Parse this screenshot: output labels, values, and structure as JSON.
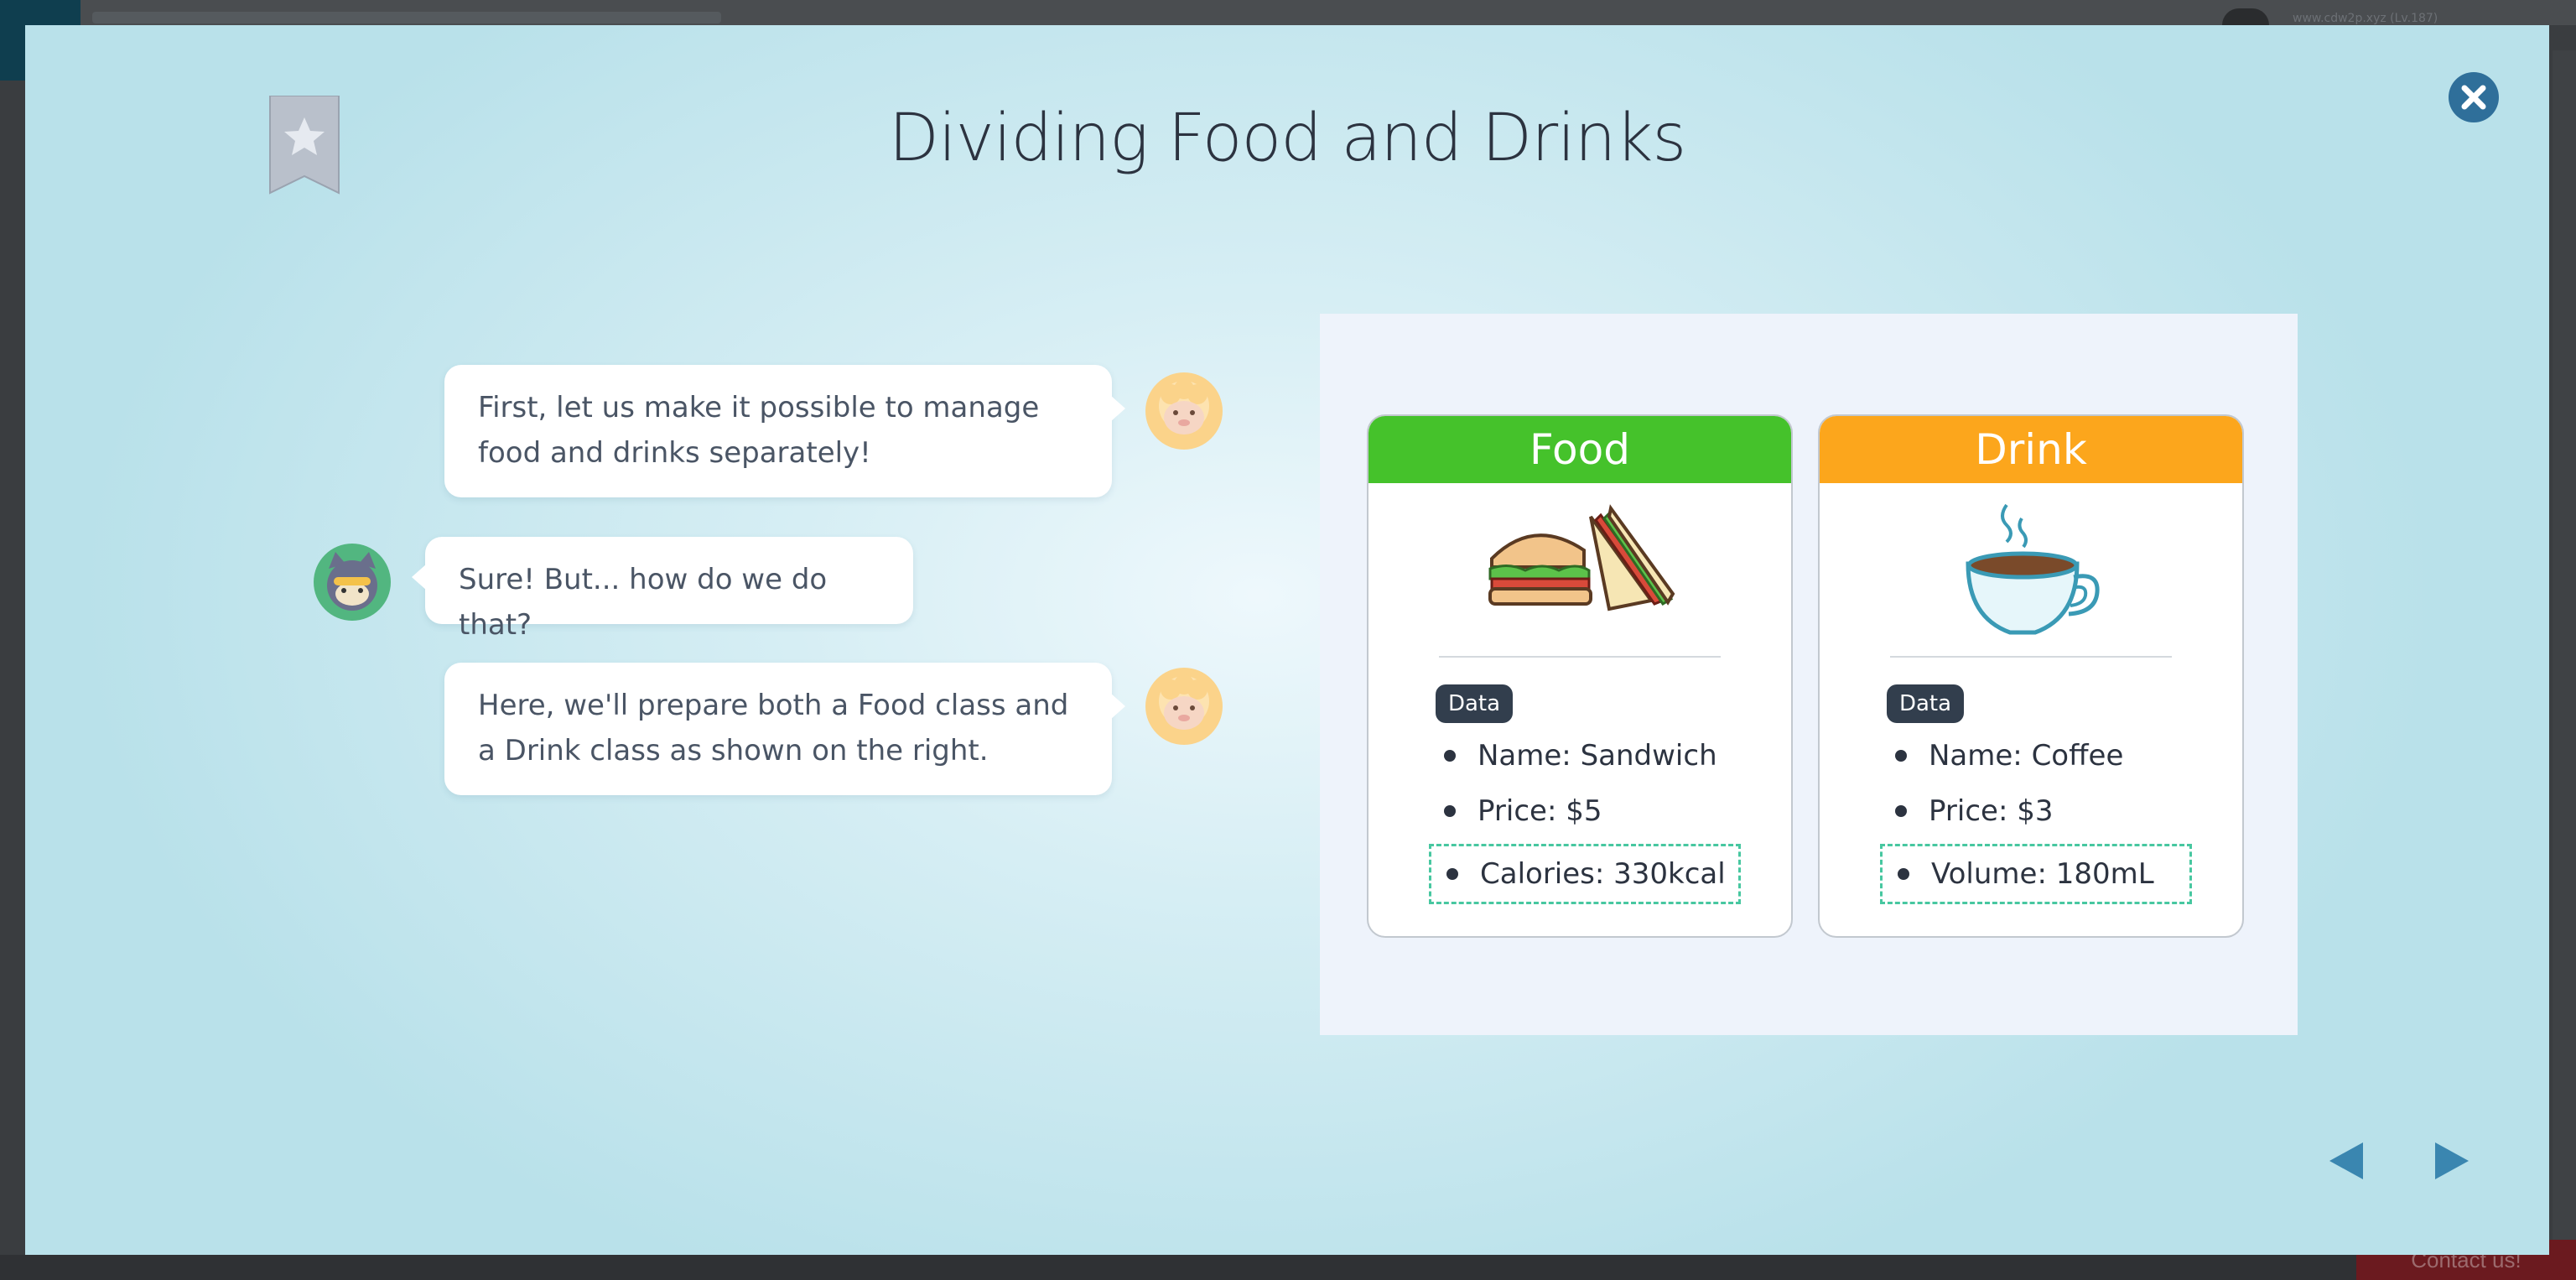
{
  "background_page": {
    "url_text": "www.cdw2p.xyz (Lv.187)",
    "contact_label": "Contact us!"
  },
  "lesson": {
    "title": "Dividing Food and Drinks",
    "bookmark_icon": "bookmark-star-icon",
    "close_icon": "close-icon"
  },
  "chat": [
    {
      "speaker": "sheep",
      "side": "right",
      "text": "First, let us make it possible to manage food and drinks separately!"
    },
    {
      "speaker": "cat",
      "side": "left",
      "text": "Sure! But... how do we do that?"
    },
    {
      "speaker": "sheep",
      "side": "right",
      "text": "Here, we'll prepare both a Food class and a Drink class as shown on the right."
    }
  ],
  "diagram": {
    "food": {
      "header": "Food",
      "tag": "Data",
      "fields": [
        "Name: Sandwich",
        "Price: $5",
        "Calories: 330kcal"
      ],
      "illustration": "sandwich-icon"
    },
    "drink": {
      "header": "Drink",
      "tag": "Data",
      "fields": [
        "Name: Coffee",
        "Price: $3",
        "Volume: 180mL"
      ],
      "illustration": "coffee-cup-icon"
    },
    "colors": {
      "food_header": "#45c22b",
      "drink_header": "#fca61c",
      "highlight_border": "#47c7a0",
      "tag_bg": "#323e4d"
    }
  },
  "navigation": {
    "prev_icon": "arrow-left-icon",
    "next_icon": "arrow-right-icon",
    "arrow_color": "#3a86b0"
  }
}
